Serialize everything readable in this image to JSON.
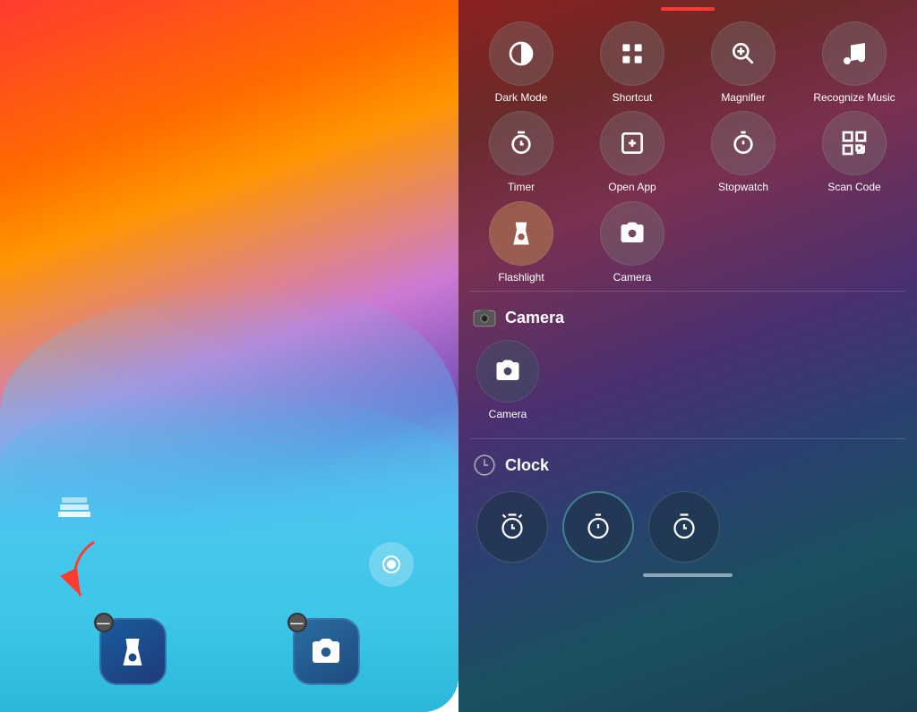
{
  "left": {
    "dock": [
      {
        "id": "flashlight",
        "label": "Flashlight",
        "hasMinus": true
      },
      {
        "id": "camera",
        "label": "Camera",
        "hasMinus": true
      }
    ]
  },
  "right": {
    "topRow": [
      {
        "id": "dark-mode",
        "label": "Dark Mode",
        "icon": "dark-mode-icon"
      },
      {
        "id": "shortcut",
        "label": "Shortcut",
        "icon": "shortcut-icon"
      },
      {
        "id": "magnifier",
        "label": "Magnifier",
        "icon": "magnifier-icon"
      },
      {
        "id": "recognize-music",
        "label": "Recognize Music",
        "icon": "music-icon"
      }
    ],
    "secondRow": [
      {
        "id": "timer",
        "label": "Timer",
        "icon": "timer-icon"
      },
      {
        "id": "open-app",
        "label": "Open App",
        "icon": "open-app-icon"
      },
      {
        "id": "stopwatch",
        "label": "Stopwatch",
        "icon": "stopwatch-icon"
      },
      {
        "id": "scan-code",
        "label": "Scan Code",
        "icon": "scan-icon"
      }
    ],
    "thirdRow": [
      {
        "id": "flashlight",
        "label": "Flashlight",
        "icon": "flashlight-icon",
        "active": true
      },
      {
        "id": "camera2",
        "label": "Camera",
        "icon": "camera-icon"
      }
    ],
    "cameraSectionTitle": "Camera",
    "cameraSubItems": [
      {
        "id": "camera-sub",
        "label": "Camera",
        "icon": "camera-icon"
      }
    ],
    "clockSectionTitle": "Clock",
    "clockSubItems": [
      {
        "id": "alarm",
        "icon": "alarm-icon"
      },
      {
        "id": "stopwatch2",
        "icon": "stopwatch2-icon"
      },
      {
        "id": "timer2",
        "icon": "timer2-icon"
      }
    ]
  }
}
